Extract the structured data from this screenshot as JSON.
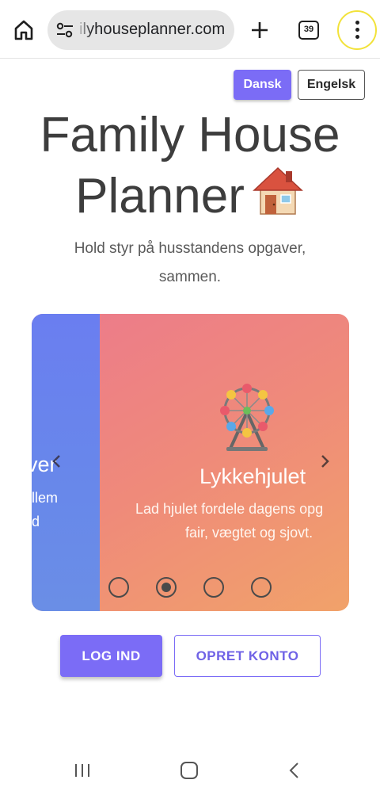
{
  "browser": {
    "url": "ilyhouseplanner.com",
    "tab_count": "39",
    "icons": [
      "home-icon",
      "site-settings-icon",
      "plus-icon",
      "tabs-icon",
      "more-vert-icon"
    ]
  },
  "language": {
    "active": "Dansk",
    "inactive": "Engelsk"
  },
  "hero": {
    "title": "Family House Planner",
    "title_emoji": "🏠",
    "subtitle": "Hold styr på husstandens opgaver, sammen."
  },
  "carousel": {
    "previous_slide": {
      "title_fragment": "ver",
      "text_line1": "llem",
      "text_line2": "d"
    },
    "current_slide": {
      "emoji": "🎡",
      "title": "Lykkehjulet",
      "description_line1": "Lad hjulet fordele dagens opg",
      "description_line2": "fair, vægtet og sjovt."
    },
    "indicator_count": 4,
    "active_index": 1,
    "colors": {
      "prev_slide": "#6a7ef0",
      "current_gradient_start": "#ec7a8c",
      "current_gradient_end": "#f1a26a"
    }
  },
  "actions": {
    "login": "LOG IND",
    "signup": "OPRET KONTO",
    "accent_color": "#7b6cf6"
  }
}
